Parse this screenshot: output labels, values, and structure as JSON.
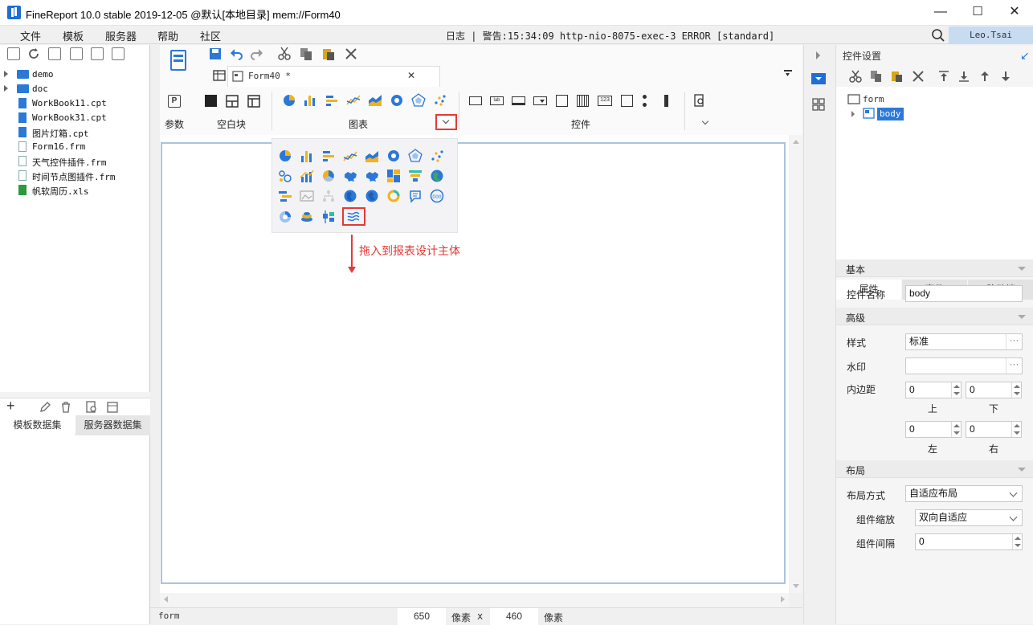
{
  "window": {
    "title": "FineReport 10.0 stable 2019-12-05 @默认[本地目录]    mem://Form40",
    "min": "—",
    "max": "☐",
    "close": "✕"
  },
  "menu": [
    "文件",
    "模板",
    "服务器",
    "帮助",
    "社区"
  ],
  "log": {
    "text": "日志 | 警告:15:34:09 http-nio-8075-exec-3 ERROR [standard]"
  },
  "user": "Leo.Tsai",
  "tree": [
    {
      "name": "demo",
      "type": "folder"
    },
    {
      "name": "doc",
      "type": "folder"
    },
    {
      "name": "WorkBook11.cpt",
      "type": "cpt"
    },
    {
      "name": "WorkBook31.cpt",
      "type": "cpt"
    },
    {
      "name": "图片灯箱.cpt",
      "type": "cpt"
    },
    {
      "name": "Form16.frm",
      "type": "frm"
    },
    {
      "name": "天气控件插件.frm",
      "type": "frm"
    },
    {
      "name": "时间节点图插件.frm",
      "type": "frm"
    },
    {
      "name": "帆软周历.xls",
      "type": "xls"
    }
  ],
  "datasetTabs": [
    "模板数据集",
    "服务器数据集"
  ],
  "tab": {
    "label": "Form40 *",
    "close": "✕"
  },
  "categories": {
    "param": "参数",
    "blank": "空白块",
    "chart": "图表",
    "widget": "控件"
  },
  "annotation": "拖入到报表设计主体",
  "status": {
    "left": "form",
    "width": "650",
    "unit1": "像素",
    "x": "x",
    "height": "460",
    "unit2": "像素"
  },
  "rightPanel": {
    "title": "控件设置",
    "tree": {
      "root": "form",
      "child": "body"
    },
    "tabs": [
      "属性",
      "事件",
      "移动端"
    ],
    "basic": "基本",
    "nameLabel": "控件名称",
    "nameValue": "body",
    "advanced": "高级",
    "styleLabel": "样式",
    "styleValue": "标准",
    "watermarkLabel": "水印",
    "paddingLabel": "内边距",
    "padTop": "0",
    "padBottom": "0",
    "padLeft": "0",
    "padRight": "0",
    "top": "上",
    "bottom": "下",
    "left": "左",
    "right": "右",
    "layout": "布局",
    "layoutModeLabel": "布局方式",
    "layoutModeValue": "自适应布局",
    "scaleLabel": "组件缩放",
    "scaleValue": "双向自适应",
    "gapLabel": "组件间隔",
    "gapValue": "0",
    "ellipsis": "···"
  },
  "colors": {
    "accent": "#1f6dd6",
    "highlight": "#e53935",
    "selection": "#c7dcf1"
  },
  "chartIcons": [
    "pie-icon",
    "bar-icon",
    "hbar-icon",
    "line-icon",
    "area-icon",
    "gauge-icon",
    "radar-icon",
    "scatter-icon",
    "bubble-icon",
    "combo-icon",
    "donut-icon",
    "map-icon",
    "map2-icon",
    "treemap-icon",
    "funnel-icon",
    "globe-map-icon",
    "gantt-icon",
    "frame-icon",
    "tree-icon",
    "earth-icon",
    "earth2-icon",
    "ring-icon",
    "word-cloud-icon",
    "number-icon",
    "rose-icon",
    "stack-icon",
    "box-icon",
    "wave-icon"
  ]
}
